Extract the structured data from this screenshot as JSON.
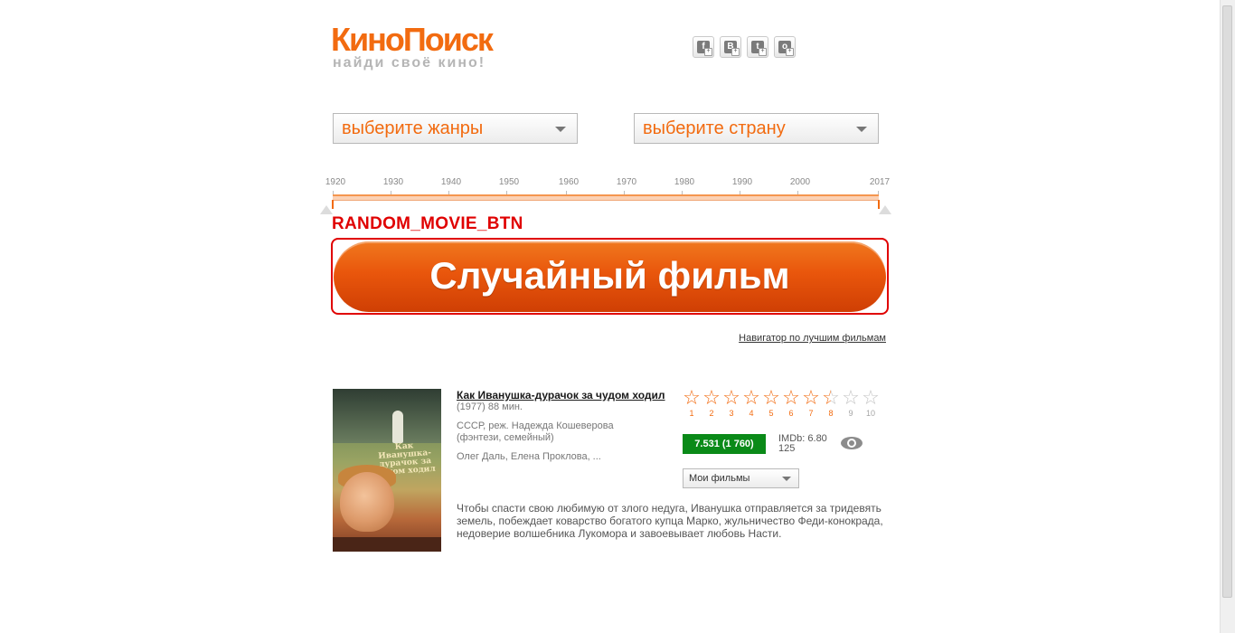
{
  "logo": {
    "main": "КиноПоиск",
    "tagline": "найди своё кино!"
  },
  "social": [
    {
      "name": "facebook",
      "glyph": "f"
    },
    {
      "name": "vkontakte",
      "glyph": "В"
    },
    {
      "name": "twitter",
      "glyph": "t"
    },
    {
      "name": "odnoklassniki",
      "glyph": "о"
    }
  ],
  "filters": {
    "genre_placeholder": "выберите жанры",
    "country_placeholder": "выберите страну"
  },
  "year_slider": {
    "labels": [
      "1920",
      "1930",
      "1940",
      "1950",
      "1960",
      "1970",
      "1980",
      "1990",
      "2000",
      "2017"
    ],
    "range": [
      1920,
      2017
    ]
  },
  "random_button": {
    "annotation": "RANDOM_MOVIE_BTN",
    "label": "Случайный фильм"
  },
  "navigator_link": "Навигатор по лучшим фильмам",
  "movie": {
    "title": "Как Иванушка-дурачок за чудом ходил",
    "year_duration": "(1977) 88 мин.",
    "country_director": "СССР, реж. Надежда Кошеверова",
    "genres": "(фэнтези, семейный)",
    "actors": "Олег Даль, Елена Проклова, ...",
    "poster_title": "Как Иванушка-дурачок за чудом ходил",
    "rating": {
      "kp": "7.531 (1 760)",
      "imdb": "IMDb: 6.80",
      "imdb_votes": "125"
    },
    "rating_stars_value": 7.531,
    "rating_scale": [
      "1",
      "2",
      "3",
      "4",
      "5",
      "6",
      "7",
      "8",
      "9",
      "10"
    ],
    "my_films_label": "Мои фильмы",
    "description": "Чтобы спасти свою любимую от злого недуга, Иванушка отправляется за тридевять земель, побеждает коварство богатого купца Марко, жульничество Феди-конокрада, недоверие волшебника Лукомора и завоевывает любовь Насти."
  },
  "colors": {
    "brand_orange": "#f26b10",
    "rating_green": "#0a8a18",
    "annotation_red": "#e00000"
  }
}
